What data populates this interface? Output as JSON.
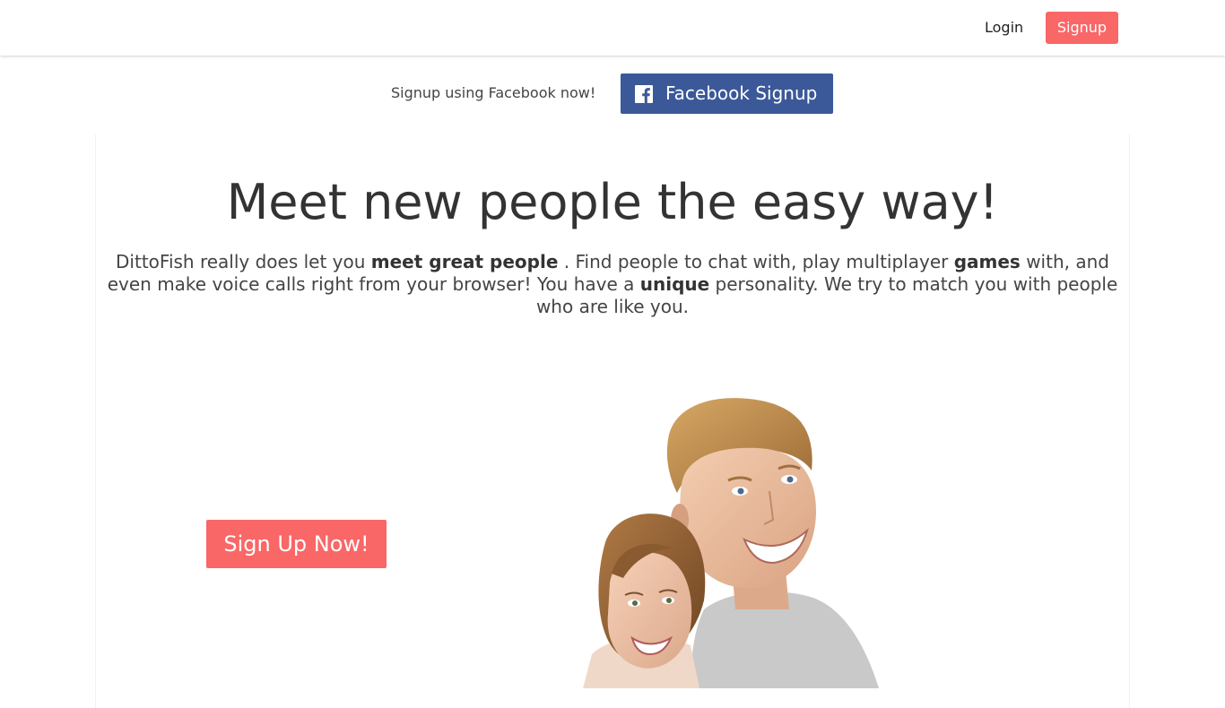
{
  "nav": {
    "login_label": "Login",
    "signup_label": "Signup"
  },
  "facebook": {
    "prompt": "Signup using Facebook now!",
    "button_label": "Facebook Signup",
    "icon": "facebook-icon"
  },
  "hero": {
    "title": "Meet new people the easy way!",
    "intro": {
      "t1": "DittoFish really does let you ",
      "b1": "meet great people",
      "t2": " . Find people to chat with, play multiplayer ",
      "b2": "games",
      "t3": " with, and even make voice calls right from your browser! You have a ",
      "b3": "unique",
      "t4": " personality. We try to match you with people who are like you."
    },
    "cta_label": "Sign Up Now!",
    "image": "smiling-couple-photo"
  },
  "colors": {
    "accent": "#f96767",
    "facebook": "#3b5998",
    "text": "#333333"
  }
}
